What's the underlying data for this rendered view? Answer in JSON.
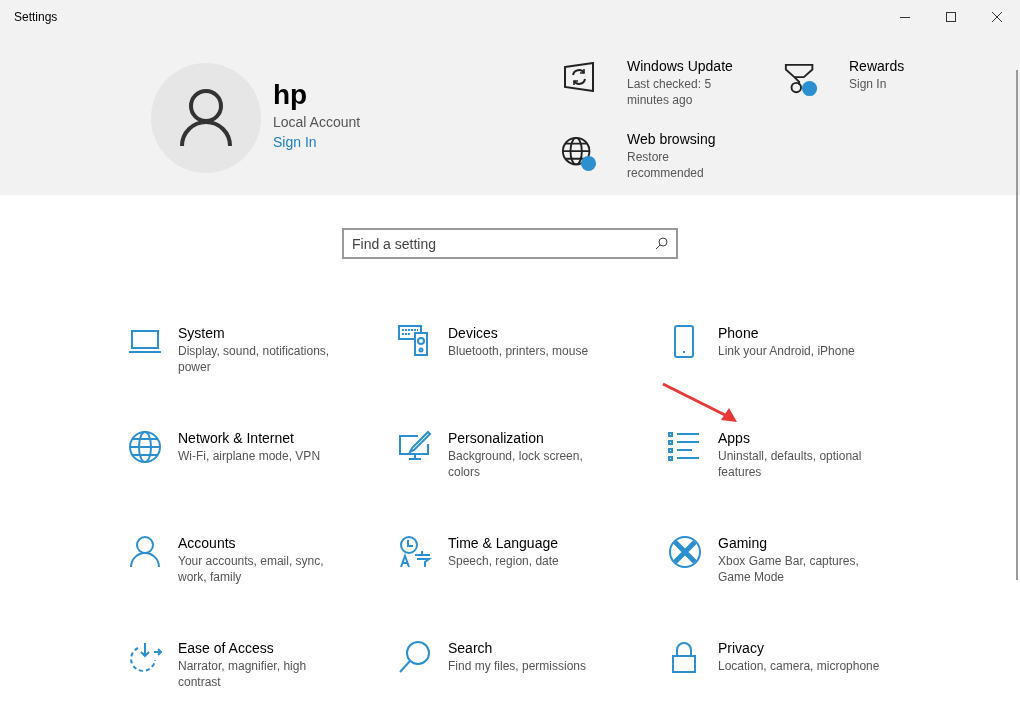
{
  "window": {
    "title": "Settings"
  },
  "account": {
    "name": "hp",
    "type": "Local Account",
    "link": "Sign In"
  },
  "status_items": [
    {
      "kind": "update",
      "title": "Windows Update",
      "detail": "Last checked: 5 minutes ago"
    },
    {
      "kind": "rewards",
      "title": "Rewards",
      "detail": "Sign In"
    },
    {
      "kind": "web",
      "title": "Web browsing",
      "detail": "Restore recommended"
    }
  ],
  "search": {
    "placeholder": "Find a setting"
  },
  "categories": [
    {
      "kind": "system",
      "title": "System",
      "detail": "Display, sound, notifications, power"
    },
    {
      "kind": "devices",
      "title": "Devices",
      "detail": "Bluetooth, printers, mouse"
    },
    {
      "kind": "phone",
      "title": "Phone",
      "detail": "Link your Android, iPhone"
    },
    {
      "kind": "network",
      "title": "Network & Internet",
      "detail": "Wi-Fi, airplane mode, VPN"
    },
    {
      "kind": "personalization",
      "title": "Personalization",
      "detail": "Background, lock screen, colors"
    },
    {
      "kind": "apps",
      "title": "Apps",
      "detail": "Uninstall, defaults, optional features"
    },
    {
      "kind": "accounts",
      "title": "Accounts",
      "detail": "Your accounts, email, sync, work, family"
    },
    {
      "kind": "time",
      "title": "Time & Language",
      "detail": "Speech, region, date"
    },
    {
      "kind": "gaming",
      "title": "Gaming",
      "detail": "Xbox Game Bar, captures, Game Mode"
    },
    {
      "kind": "ease",
      "title": "Ease of Access",
      "detail": "Narrator, magnifier, high contrast"
    },
    {
      "kind": "search",
      "title": "Search",
      "detail": "Find my files, permissions"
    },
    {
      "kind": "privacy",
      "title": "Privacy",
      "detail": "Location, camera, microphone"
    }
  ]
}
